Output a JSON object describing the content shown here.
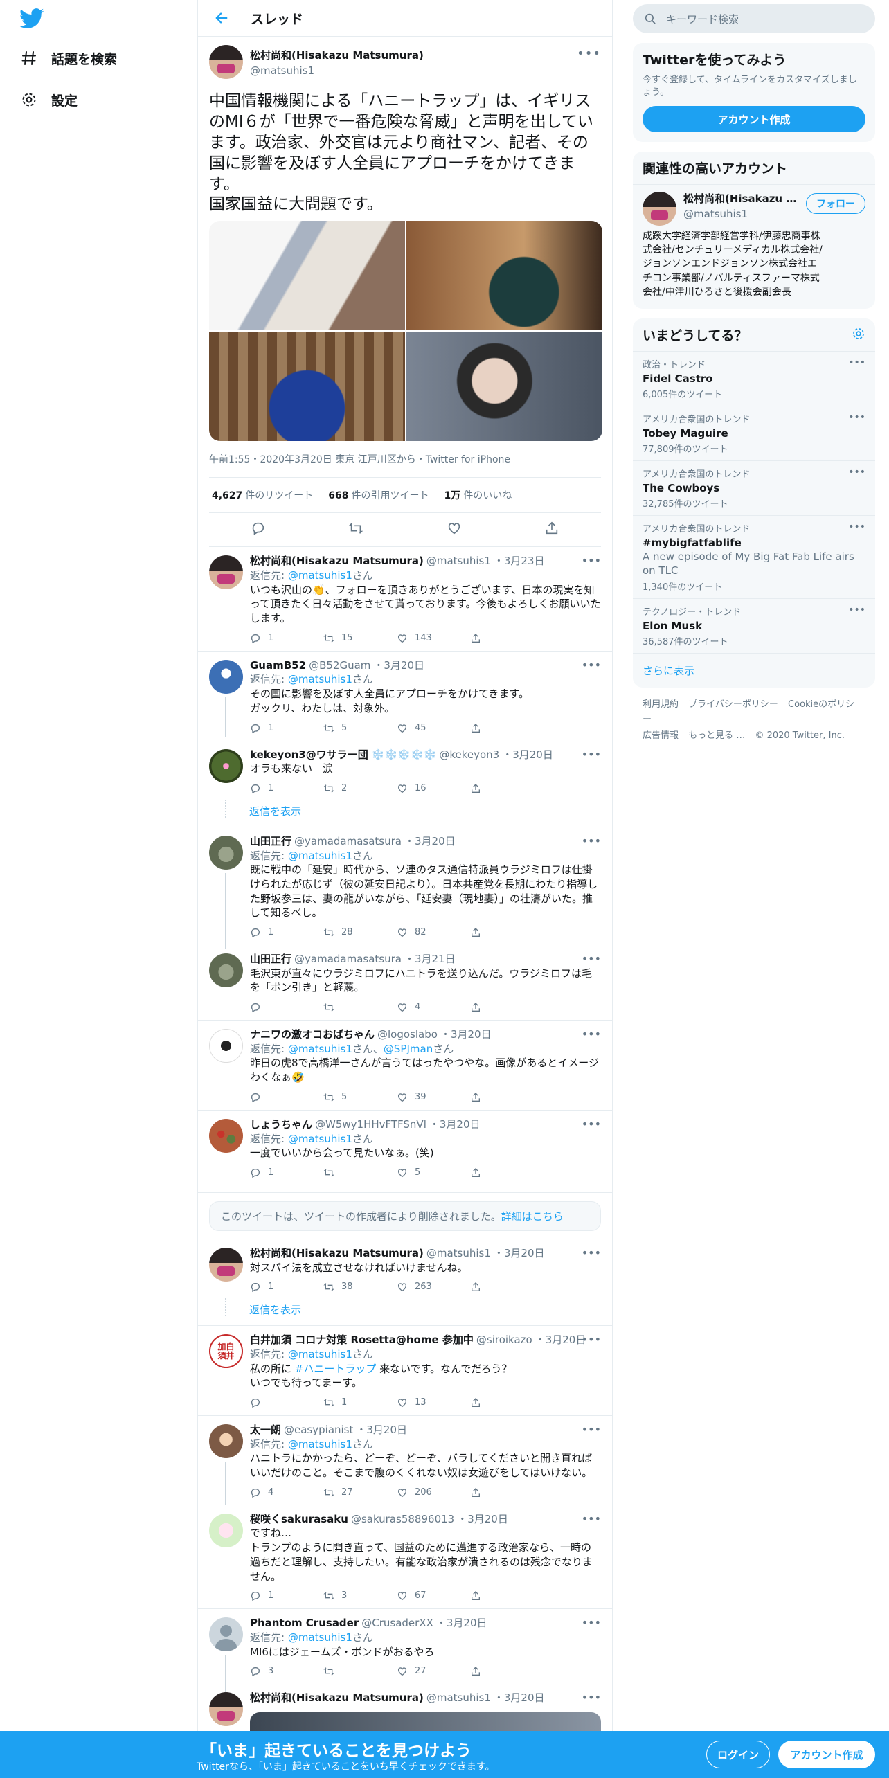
{
  "nav": {
    "explore": "話題を検索",
    "settings": "設定"
  },
  "header": {
    "title": "スレッド"
  },
  "main_tweet": {
    "name": "松村尚和(Hisakazu Matsumura)",
    "handle": "@matsuhis1",
    "text": "中国情報機関による「ハニートラップ」は、イギリスのMI６が「世界で一番危険な脅威」と声明を出しています。政治家、外交官は元より商社マン、記者、その国に影響を及ぼす人全員にアプローチをかけてきます。\n国家国益に大問題です。",
    "meta": "午前1:55・2020年3月20日 東京 江戸川区から・Twitter for iPhone",
    "retweets": "4,627",
    "retweets_label": "件のリツイート",
    "quotes": "668",
    "quotes_label": "件の引用ツイート",
    "likes": "1万",
    "likes_label": "件のいいね"
  },
  "replies": [
    {
      "name": "松村尚和(Hisakazu Matsumura)",
      "handle": "@matsuhis1",
      "date": "・3月23日",
      "to_label": "返信先:",
      "to": "@matsuhis1",
      "to_suffix": "さん",
      "text": "いつも沢山の👏、フォローを頂きありがとうございます、日本の現実を知って頂きたく日々活動をさせて貰っております。今後もよろしくお願いいたします。",
      "reply": "1",
      "rt": "15",
      "like": "143"
    },
    {
      "name": "GuamB52",
      "handle": "@B52Guam",
      "date": "・3月20日",
      "to_label": "返信先:",
      "to": "@matsuhis1",
      "to_suffix": "さん",
      "text": "その国に影響を及ぼす人全員にアプローチをかけてきます。\nガックリ、わたしは、対象外。",
      "reply": "1",
      "rt": "5",
      "like": "45"
    },
    {
      "name": "kekeyon3@ワサラー団 ❄️❄️❄️❄️❄️",
      "handle": "@kekeyon3",
      "date": "・3月20日",
      "text": "オラも来ない　涙",
      "reply": "1",
      "rt": "2",
      "like": "16"
    },
    {
      "name": "山田正行",
      "handle": "@yamadamasatsura",
      "date": "・3月20日",
      "to_label": "返信先:",
      "to": "@matsuhis1",
      "to_suffix": "さん",
      "text": "既に戦中の「延安」時代から、ソ連のタス通信特派員ウラジミロフは仕掛けられたが応じず（彼の延安日記より）。日本共産党を長期にわたり指導した野坂参三は、妻の龍がいながら、「延安妻（現地妻）」の壮濤がいた。推して知るべし。",
      "reply": "1",
      "rt": "28",
      "like": "82"
    },
    {
      "name": "山田正行",
      "handle": "@yamadamasatsura",
      "date": "・3月21日",
      "text": "毛沢東が直々にウラジミロフにハニトラを送り込んだ。ウラジミロフは毛を「ポン引き」と軽蔑。",
      "reply": "",
      "rt": "",
      "like": "4"
    },
    {
      "name": "ナニワの激オコおばちゃん",
      "handle": "@logoslabo",
      "date": "・3月20日",
      "to_label": "返信先:",
      "to": "@matsuhis1",
      "to_mid": "さん、",
      "to2": "@SPJman",
      "to_suffix": "さん",
      "text": "昨日の虎8で高橋洋一さんが言うてはったやつやな。画像があるとイメージわくなぁ🤣",
      "reply": "",
      "rt": "5",
      "like": "39"
    },
    {
      "name": "しょうちゃん",
      "handle": "@W5wy1HHvFTFSnVl",
      "date": "・3月20日",
      "to_label": "返信先:",
      "to": "@matsuhis1",
      "to_suffix": "さん",
      "text": "一度でいいから会って見たいなぁ。(笑)",
      "reply": "1",
      "rt": "",
      "like": "5"
    },
    {
      "name": "松村尚和(Hisakazu Matsumura)",
      "handle": "@matsuhis1",
      "date": "・3月20日",
      "text": "対スパイ法を成立させなければいけませんね。",
      "reply": "1",
      "rt": "38",
      "like": "263"
    },
    {
      "name": "白井加須 コロナ対策 Rosetta@home 参加中",
      "handle": "@siroikazo",
      "date": "・3月20日",
      "to_label": "返信先:",
      "to": "@matsuhis1",
      "to_suffix": "さん",
      "text_pre": "私の所に ",
      "hashtag": "#ハニートラップ",
      "text_post": " 来ないです。なんでだろう？\nいつでも待ってまーす。",
      "reply": "",
      "rt": "1",
      "like": "13"
    },
    {
      "name": "太一朗",
      "handle": "@easypianist",
      "date": "・3月20日",
      "to_label": "返信先:",
      "to": "@matsuhis1",
      "to_suffix": "さん",
      "text": "ハニトラにかかったら、どーぞ、どーぞ、バラしてくださいと開き直ればいいだけのこと。そこまで腹のくくれない奴は女遊びをしてはいけない。",
      "reply": "4",
      "rt": "27",
      "like": "206"
    },
    {
      "name": "桜咲くsakurasaku",
      "handle": "@sakuras58896013",
      "date": "・3月20日",
      "text": "ですね…\nトランプのように開き直って、国益のために邁進する政治家なら、一時の過ちだと理解し、支持したい。有能な政治家が潰されるのは残念でなりません。",
      "reply": "1",
      "rt": "3",
      "like": "67"
    },
    {
      "name": "Phantom Crusader",
      "handle": "@CrusaderXX",
      "date": "・3月20日",
      "to_label": "返信先:",
      "to": "@matsuhis1",
      "to_suffix": "さん",
      "text": "MI6にはジェームズ・ボンドがおるやろ",
      "reply": "3",
      "rt": "",
      "like": "27"
    },
    {
      "name": "松村尚和(Hisakazu Matsumura)",
      "handle": "@matsuhis1",
      "date": "・3月20日"
    }
  ],
  "show_replies": "返信を表示",
  "deleted": {
    "text": "このツイートは、ツイートの作成者により削除されました。",
    "link": "詳細はこちら"
  },
  "shirai_avatar_text": "加白\n須井",
  "right": {
    "search_placeholder": "キーワード検索",
    "try_title": "Twitterを使ってみよう",
    "try_sub": "今すぐ登録して、タイムラインをカスタマイズしましょう。",
    "create_account": "アカウント作成",
    "relevant_title": "関連性の高いアカウント",
    "rel_name": "松村尚和(Hisakazu Matsumura)",
    "rel_handle": "@matsuhis1",
    "follow": "フォロー",
    "rel_bio": "成蹊大学経済学部経営学科/伊藤忠商事株式会社/センチュリーメディカル株式会社/ジョンソンエンドジョンソン株式会社エチコン事業部/ノバルティスファーマ株式会社/中津川ひろさと後援会副会長",
    "trends_title": "いまどうしてる？",
    "trends": [
      {
        "cat": "政治・トレンド",
        "name": "Fidel Castro",
        "count": "6,005件のツイート"
      },
      {
        "cat": "アメリカ合衆国のトレンド",
        "name": "Tobey Maguire",
        "count": "77,809件のツイート"
      },
      {
        "cat": "アメリカ合衆国のトレンド",
        "name": "The Cowboys",
        "count": "32,785件のツイート"
      },
      {
        "cat": "アメリカ合衆国のトレンド",
        "name": "#mybigfatfablife",
        "desc": "A new episode of My Big Fat Fab Life airs on TLC",
        "count": "1,340件のツイート"
      },
      {
        "cat": "テクノロジー・トレンド",
        "name": "Elon Musk",
        "count": "36,587件のツイート"
      }
    ],
    "more": "さらに表示",
    "footer": [
      "利用規約",
      "プライバシーポリシー",
      "Cookieのポリシー",
      "広告情報",
      "もっと見る …",
      "© 2020 Twitter, Inc."
    ]
  },
  "bottom": {
    "title": "「いま」起きていることを見つけよう",
    "sub": "Twitterなら、「いま」起きていることをいち早くチェックできます。",
    "login": "ログイン",
    "signup": "アカウント作成"
  },
  "colors": {
    "accent": "#1da1f2",
    "text": "#14171a",
    "muted": "#657786",
    "border": "#e6ecf0"
  }
}
